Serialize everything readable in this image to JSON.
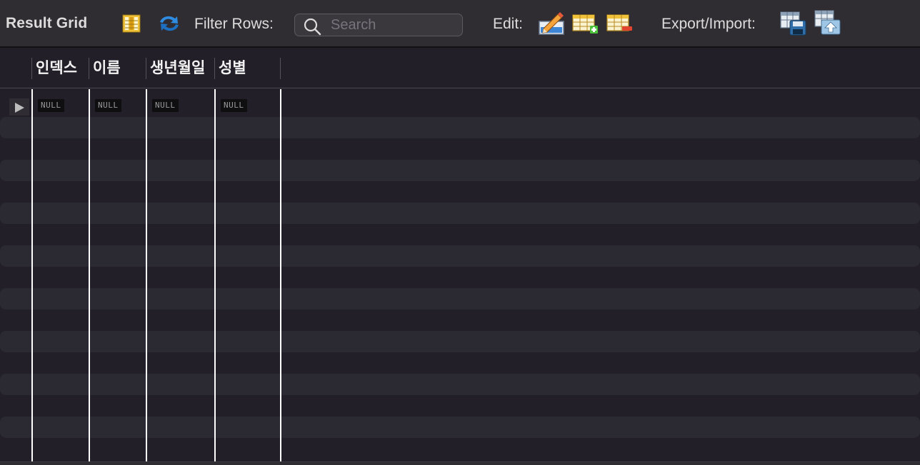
{
  "toolbar": {
    "title": "Result Grid",
    "filter_label": "Filter Rows:",
    "search_placeholder": "Search",
    "search_value": "",
    "edit_label": "Edit:",
    "export_label": "Export/Import:",
    "icons": {
      "columns_toggle": "columns-toggle-icon",
      "refresh": "refresh-icon",
      "search": "search-icon",
      "edit_cell": "edit-pencil-icon",
      "insert_row": "insert-row-icon",
      "delete_row": "delete-row-icon",
      "export": "export-save-icon",
      "import": "import-icon"
    }
  },
  "grid": {
    "columns": [
      "인덱스",
      "이름",
      "생년월일",
      "성별"
    ],
    "rows": [
      [
        "NULL",
        "NULL",
        "NULL",
        "NULL"
      ]
    ],
    "current_row_marker": "row-pointer-icon"
  },
  "colors": {
    "toolbar_bg": "#2f2d32",
    "grid_bg": "#221f29",
    "stripe": "#2b2932",
    "null_badge_bg": "#0f0e11",
    "column_divider": "#ffffff"
  }
}
